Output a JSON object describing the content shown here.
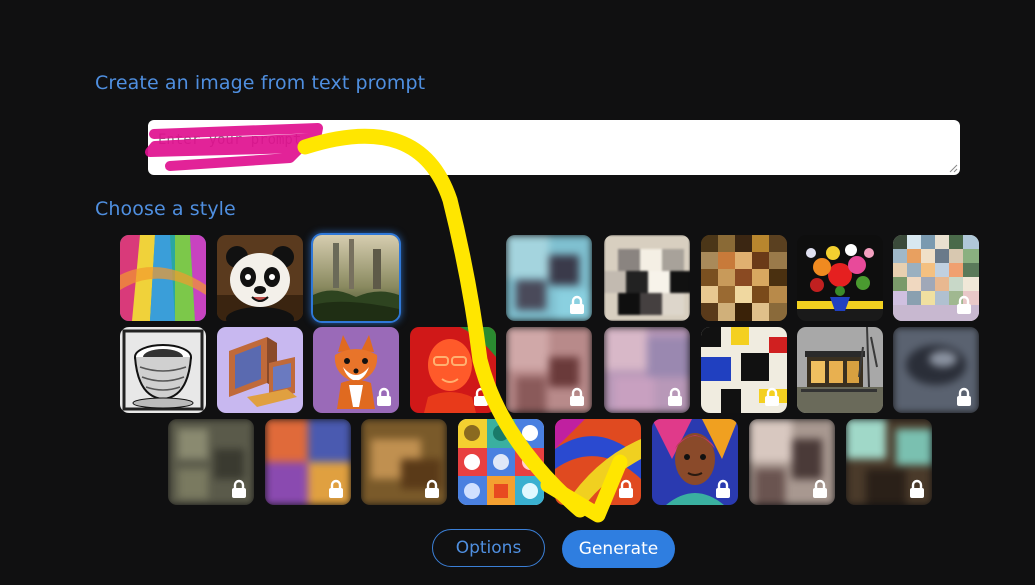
{
  "header": {
    "create_label": "Create an image from text prompt"
  },
  "prompt": {
    "placeholder": "Enter your prompt",
    "value": ""
  },
  "styles_section": {
    "label": "Choose a style"
  },
  "style_tiles": {
    "row1": [
      "abstract-paint",
      "panda",
      "fantasy-landscape",
      "locked-style",
      "locked-style",
      "locked-style",
      "flowers",
      "locked-style"
    ],
    "row2": [
      "sketch-cup",
      "isometric-computer",
      "cartoon-fox",
      "neon-portrait",
      "locked-style",
      "locked-style",
      "mondrian",
      "modern-house",
      "locked-style"
    ],
    "row3": [
      "locked-style",
      "locked-style",
      "locked-style",
      "icon-grid",
      "locked-style",
      "colorful-portrait",
      "locked-style",
      "locked-style"
    ]
  },
  "actions": {
    "options_label": "Options",
    "generate_label": "Generate"
  },
  "colors": {
    "background": "#101011",
    "accent": "#2f7ee0",
    "annotation_arrow": "#ffe600",
    "annotation_highlight": "#e0108f"
  }
}
